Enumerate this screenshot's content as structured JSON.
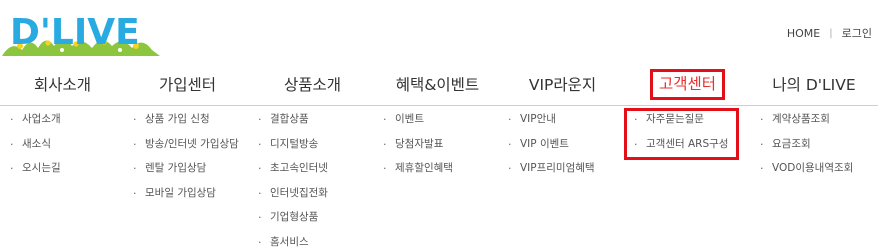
{
  "logo": {
    "text": "D'LIVE",
    "icon": "dlive-logo"
  },
  "utility": {
    "home": "HOME",
    "separator": "|",
    "login": "로그인"
  },
  "nav": [
    {
      "label": "회사소개",
      "items": [
        "사업소개",
        "새소식",
        "오시는길"
      ]
    },
    {
      "label": "가입센터",
      "items": [
        "상품 가입 신청",
        "방송/인터넷 가입상담",
        "렌탈 가입상담",
        "모바일 가입상담"
      ]
    },
    {
      "label": "상품소개",
      "items": [
        "결합상품",
        "디지털방송",
        "초고속인터넷",
        "인터넷집전화",
        "기업형상품",
        "홈서비스"
      ]
    },
    {
      "label": "혜택&이벤트",
      "items": [
        "이벤트",
        "당첨자발표",
        "제휴할인혜택"
      ]
    },
    {
      "label": "VIP라운지",
      "items": [
        "VIP안내",
        "VIP 이벤트",
        "VIP프리미엄혜택"
      ]
    },
    {
      "label": "고객센터",
      "items": [
        "자주묻는질문",
        "고객센터 ARS구성"
      ]
    },
    {
      "label": "나의 D'LIVE",
      "items": [
        "계약상품조회",
        "요금조회",
        "VOD이용내역조회"
      ]
    }
  ],
  "colors": {
    "accent": "#e8302f",
    "highlight_border": "#e30f18",
    "logo_green": "#8cc63f",
    "logo_blue": "#29abe2"
  }
}
